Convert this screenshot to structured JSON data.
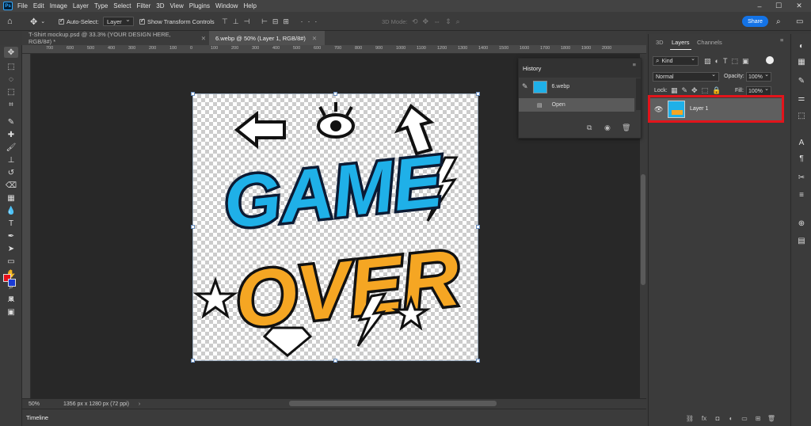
{
  "app": {
    "logo": "Ps"
  },
  "menu": [
    "File",
    "Edit",
    "Image",
    "Layer",
    "Type",
    "Select",
    "Filter",
    "3D",
    "View",
    "Plugins",
    "Window",
    "Help"
  ],
  "options": {
    "auto_select_label": "Auto-Select:",
    "auto_select_value": "Layer",
    "transform_controls_label": "Show Transform Controls",
    "mode_3d_label": "3D Mode:",
    "share_label": "Share"
  },
  "tabs": [
    {
      "label": "T-Shirt mockup.psd @ 33.3% (YOUR DESIGN HERE, RGB/8#) *",
      "active": false
    },
    {
      "label": "6.webp @ 50% (Layer 1, RGB/8#)",
      "active": true
    }
  ],
  "ruler": {
    "marks": [
      "700",
      "600",
      "500",
      "400",
      "300",
      "200",
      "100",
      "0",
      "100",
      "200",
      "300",
      "400",
      "500",
      "600",
      "700",
      "800",
      "900",
      "1000",
      "1100",
      "1200",
      "1300",
      "1400",
      "1500",
      "1600",
      "1700",
      "1800",
      "1900",
      "2000"
    ]
  },
  "canvas": {
    "artwork_line1": "GAME",
    "artwork_line2": "OVER"
  },
  "status": {
    "zoom": "50%",
    "doc_info": "1356 px x 1280 px (72 ppi)"
  },
  "timeline_label": "Timeline",
  "history": {
    "title": "History",
    "snapshot_name": "6.webp",
    "states": [
      "Open"
    ]
  },
  "panels": {
    "tabs": [
      "3D",
      "Layers",
      "Channels"
    ],
    "active_tab": "Layers",
    "filter_kind": "Kind",
    "blend_mode": "Normal",
    "opacity_label": "Opacity:",
    "opacity_value": "100%",
    "lock_label": "Lock:",
    "fill_label": "Fill:",
    "fill_value": "100%",
    "layers": [
      {
        "name": "Layer 1",
        "visible": true,
        "selected": true
      }
    ]
  },
  "colors": {
    "accent_blue": "#1473e6",
    "highlight_red": "#e2141b",
    "foreground": "#e8101a",
    "background": "#1a3bd6"
  }
}
